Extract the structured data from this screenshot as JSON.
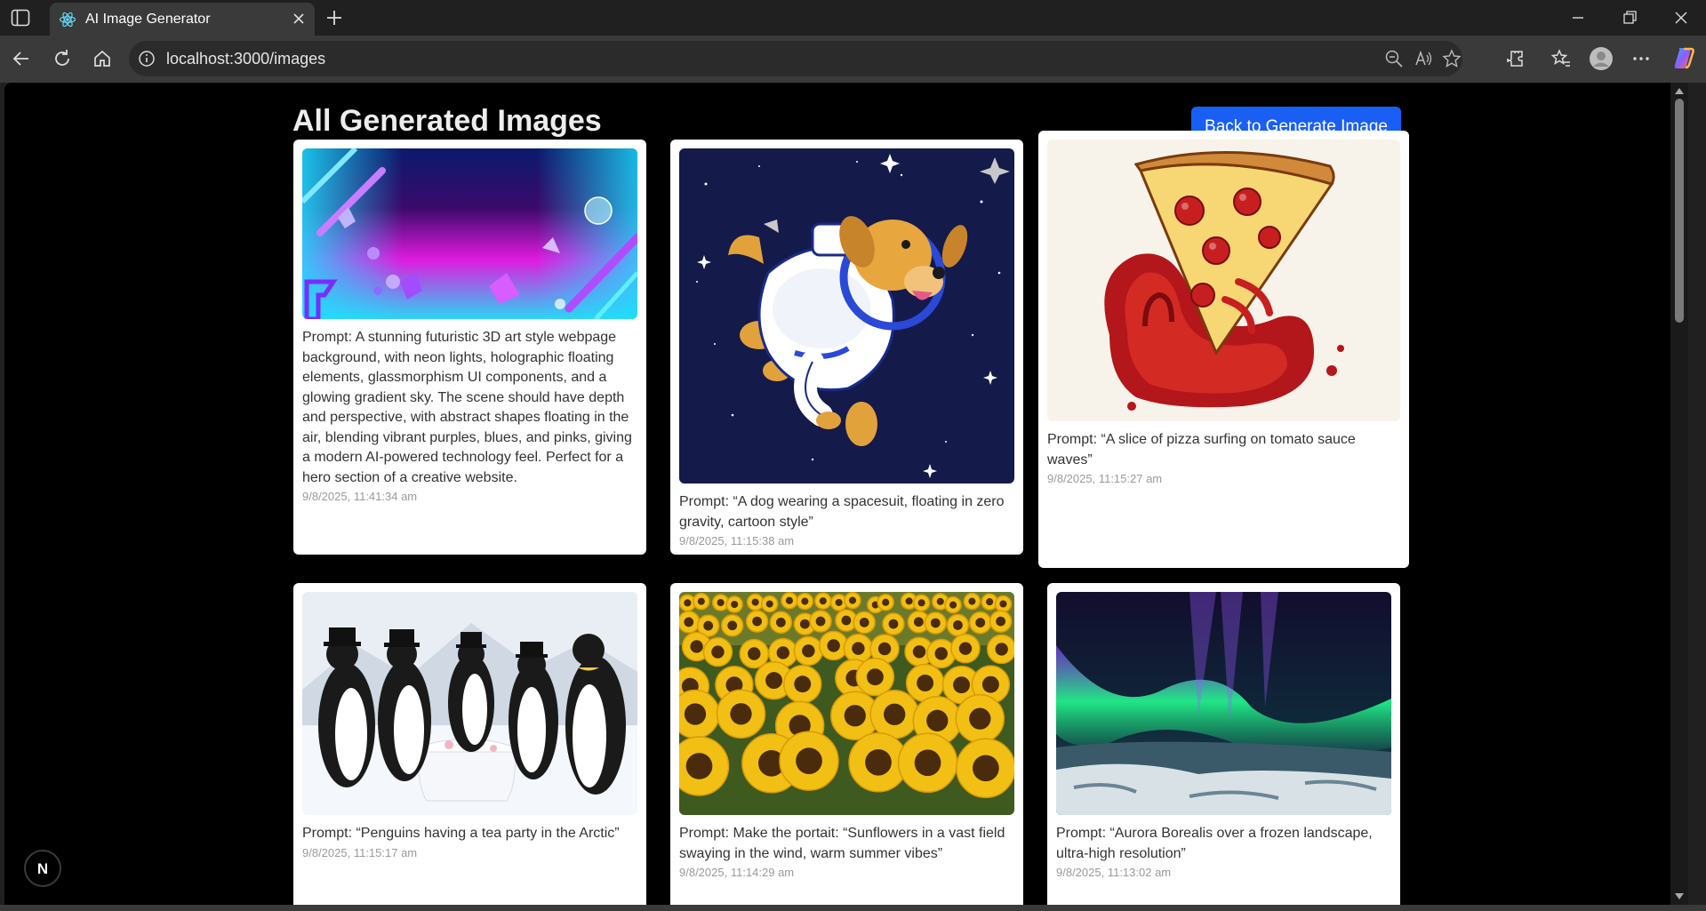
{
  "browser": {
    "tab_title": "AI Image Generator",
    "url": "localhost:3000/images"
  },
  "page": {
    "title": "All Generated Images",
    "back_button_label": "Back to Generate Image"
  },
  "images": [
    {
      "prompt": "Prompt: A stunning futuristic 3D art style webpage background, with neon lights, holographic floating elements, glassmorphism UI components, and a glowing gradient sky. The scene should have depth and perspective, with abstract shapes floating in the air, blending vibrant purples, blues, and pinks, giving a modern AI-powered technology feel. Perfect for a hero section of a creative website.",
      "date": "9/8/2025, 11:41:34 am",
      "subject": "neon abstract background"
    },
    {
      "prompt": "Prompt: “A dog wearing a spacesuit, floating in zero gravity, cartoon style”",
      "date": "9/8/2025, 11:15:38 am",
      "subject": "dog astronaut in space"
    },
    {
      "prompt": "Prompt: “A slice of pizza surfing on tomato sauce waves”",
      "date": "9/8/2025, 11:15:27 am",
      "subject": "pizza slice on sauce wave"
    },
    {
      "prompt": "Prompt: “Penguins having a tea party in the Arctic”",
      "date": "9/8/2025, 11:15:17 am",
      "subject": "penguins tea party"
    },
    {
      "prompt": "Prompt: Make the portait: “Sunflowers in a vast field swaying in the wind, warm summer vibes”",
      "date": "9/8/2025, 11:14:29 am",
      "subject": "sunflower field"
    },
    {
      "prompt": "Prompt: “Aurora Borealis over a frozen landscape, ultra-high resolution”",
      "date": "9/8/2025, 11:13:02 am",
      "subject": "aurora borealis"
    }
  ],
  "nextjs_badge": "N",
  "colors": {
    "accent": "#1a5ff5",
    "page_bg": "#000000",
    "card_bg": "#ffffff"
  }
}
